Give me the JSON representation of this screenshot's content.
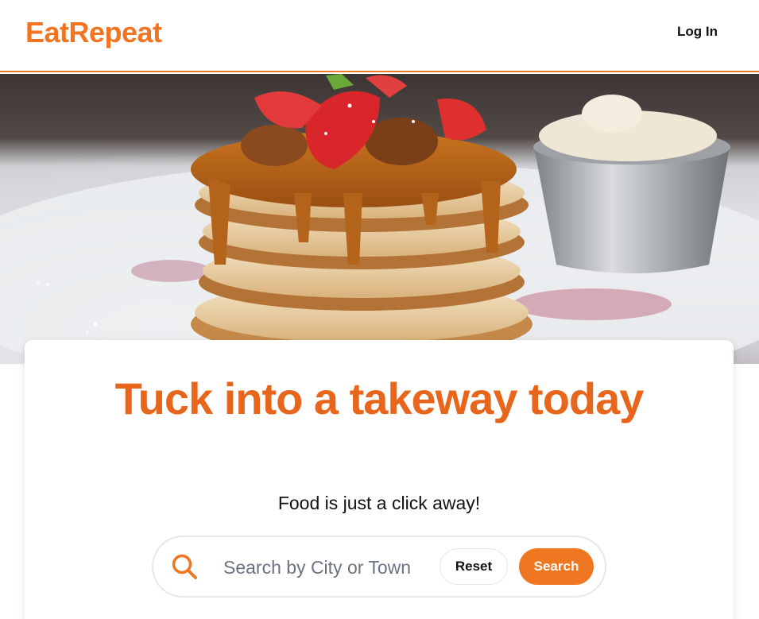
{
  "header": {
    "logo": "EatRepeat",
    "login_label": "Log In"
  },
  "hero": {
    "image": "pancake-stack-photo"
  },
  "card": {
    "headline": "Tuck into a takeway today",
    "subtitle": "Food is just a click away!"
  },
  "search": {
    "icon": "search-icon",
    "placeholder": "Search by City or Town",
    "value": "",
    "reset_label": "Reset",
    "search_label": "Search"
  },
  "colors": {
    "brand": "#f27320",
    "headline": "#e8661c",
    "search_button": "#f07722"
  }
}
